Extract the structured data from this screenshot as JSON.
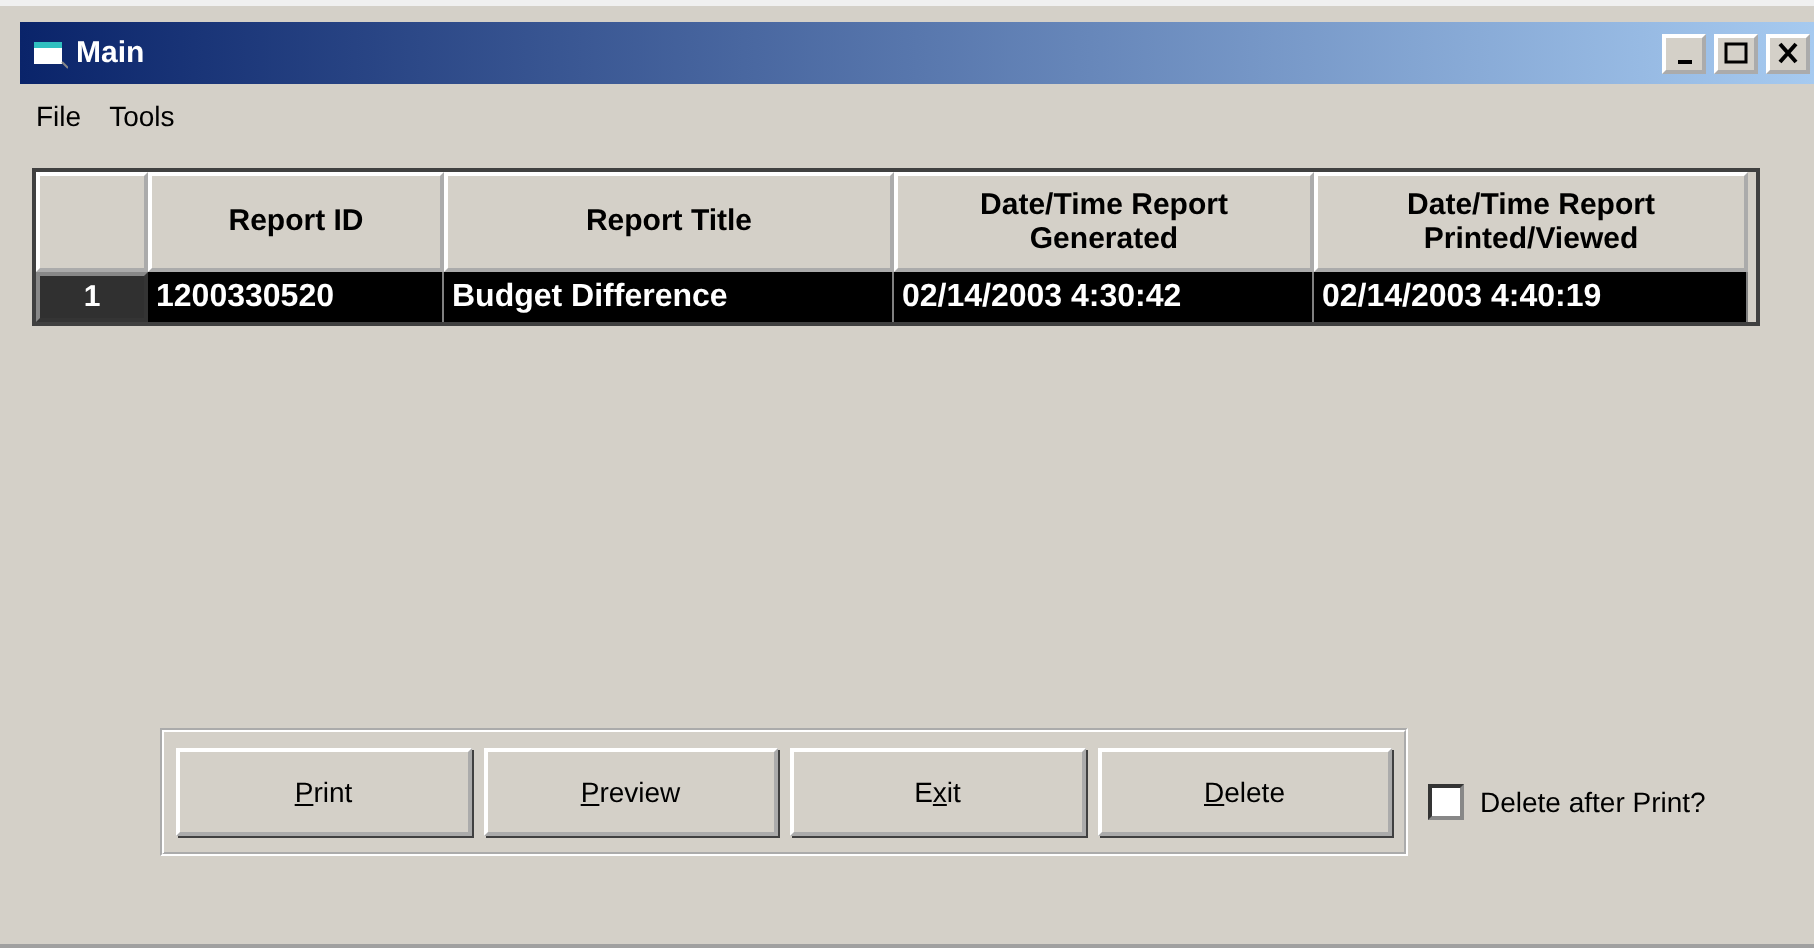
{
  "window": {
    "title": "Main",
    "controls": [
      {
        "kind": "minimize"
      },
      {
        "kind": "maximize"
      },
      {
        "kind": "close"
      }
    ]
  },
  "menu": [
    "File",
    "Tools"
  ],
  "table": {
    "columns": [
      {
        "label": "Report ID"
      },
      {
        "label": "Report Title"
      },
      {
        "label": "Date/Time Report\nGenerated"
      },
      {
        "label": "Date/Time Report\nPrinted/Viewed"
      }
    ],
    "rows": [
      {
        "number": "1",
        "selected": true,
        "cells": [
          "1200330520",
          "Budget Difference",
          "02/14/2003 4:30:42",
          "02/14/2003 4:40:19"
        ]
      }
    ]
  },
  "buttons": [
    {
      "key": "P",
      "after": "rint"
    },
    {
      "key": "P",
      "after": "review"
    },
    {
      "before": "E",
      "key": "x",
      "after": "it"
    },
    {
      "key": "D",
      "after": "elete"
    }
  ],
  "delete_after_print": {
    "label": "Delete after Print?",
    "checked": false
  }
}
